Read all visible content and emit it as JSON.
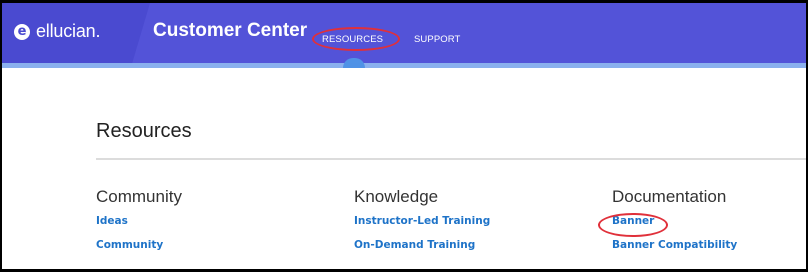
{
  "header": {
    "logo_text": "ellucian.",
    "logo_mark": "e",
    "app_title": "Customer Center",
    "nav": [
      {
        "label": "RESOURCES"
      },
      {
        "label": "SUPPORT"
      }
    ]
  },
  "main": {
    "title": "Resources",
    "columns": [
      {
        "heading": "Community",
        "links": [
          "Ideas",
          "Community"
        ]
      },
      {
        "heading": "Knowledge",
        "links": [
          "Instructor-Led Training",
          "On-Demand Training"
        ]
      },
      {
        "heading": "Documentation",
        "links": [
          "Banner",
          "Banner Compatibility"
        ]
      }
    ]
  },
  "colors": {
    "nav_background": "#5353d8",
    "logo_panel": "#4a4ad0",
    "link": "#1e73c8",
    "annotation": "#e0303a",
    "nav_underline": "#8ab0ee"
  },
  "icons": {
    "logo": "ellucian-logo-icon"
  }
}
